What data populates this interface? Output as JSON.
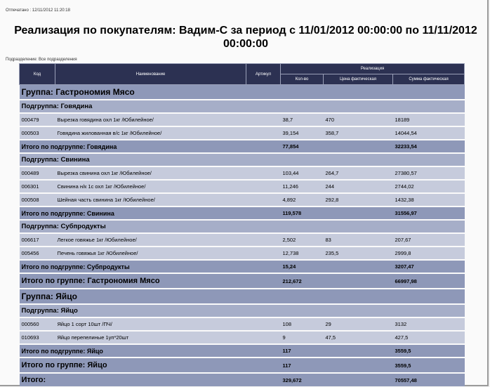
{
  "printed_label": "Отпечатано : 12/11/2012 11:20:18",
  "title": "Реализация по покупателям: Вадим-С за период с 11/01/2012 00:00:00 по 11/11/2012 00:00:00",
  "division_label": "Подразделение: Все подразделения",
  "headers": {
    "code": "Код",
    "name": "Наименование",
    "article": "Артикул",
    "sales": "Реализация",
    "qty": "Кол-во",
    "price": "Цена фактическая",
    "sum": "Сумма фактическая"
  },
  "rows": [
    {
      "type": "group",
      "label": "Группа: Гастрономия Мясо"
    },
    {
      "type": "sub",
      "label": "Подгруппа: Говядина"
    },
    {
      "type": "item",
      "code": "000479",
      "name": "Вырезка говядина охл 1кг /Юбилейное/",
      "article": "",
      "qty": "38,7",
      "price": "470",
      "sum": "18189"
    },
    {
      "type": "item",
      "code": "000503",
      "name": "Говядина жилованная в/с 1кг /Юбилейное/",
      "article": "",
      "qty": "39,154",
      "price": "358,7",
      "sum": "14044,54"
    },
    {
      "type": "subtotal",
      "label": "Итого по подгруппе: Говядина",
      "qty": "77,854",
      "sum": "32233,54"
    },
    {
      "type": "sub",
      "label": "Подгруппа: Свинина"
    },
    {
      "type": "item",
      "code": "000489",
      "name": "Вырезка свинина охл 1кг /Юбилейное/",
      "article": "",
      "qty": "103,44",
      "price": "264,7",
      "sum": "27380,57"
    },
    {
      "type": "item",
      "code": "006301",
      "name": "Свинина н/к 1с охл 1кг /Юбилейное/",
      "article": "",
      "qty": "11,246",
      "price": "244",
      "sum": "2744,02"
    },
    {
      "type": "item",
      "code": "000508",
      "name": "Шейная часть свинина 1кг /Юбилейное/",
      "article": "",
      "qty": "4,892",
      "price": "292,8",
      "sum": "1432,38"
    },
    {
      "type": "subtotal",
      "label": "Итого по подгруппе: Свинина",
      "qty": "119,578",
      "sum": "31556,97"
    },
    {
      "type": "sub",
      "label": "Подгруппа: Субпродукты"
    },
    {
      "type": "item",
      "code": "006617",
      "name": "Легкое говяжье 1кг /Юбилейное/",
      "article": "",
      "qty": "2,502",
      "price": "83",
      "sum": "207,67"
    },
    {
      "type": "item",
      "code": "005456",
      "name": "Печень говяжья 1кг /Юбилейное/",
      "article": "",
      "qty": "12,738",
      "price": "235,5",
      "sum": "2999,8"
    },
    {
      "type": "subtotal",
      "label": "Итого по подгруппе: Субпродукты",
      "qty": "15,24",
      "sum": "3207,47"
    },
    {
      "type": "gtotal",
      "label": "Итого по группе: Гастрономия Мясо",
      "qty": "212,672",
      "sum": "66997,98"
    },
    {
      "type": "group",
      "label": "Группа: Яйцо"
    },
    {
      "type": "sub",
      "label": "Подгруппа: Яйцо"
    },
    {
      "type": "item",
      "code": "000560",
      "name": "Яйцо 1 сорт 10шт /ПЧ/",
      "article": "",
      "qty": "108",
      "price": "29",
      "sum": "3132"
    },
    {
      "type": "item",
      "code": "010693",
      "name": "Яйцо перепелиные 1уп*20шт",
      "article": "",
      "qty": "9",
      "price": "47,5",
      "sum": "427,5"
    },
    {
      "type": "subtotal",
      "label": "Итого по подгруппе: Яйцо",
      "qty": "117",
      "sum": "3559,5"
    },
    {
      "type": "gtotal",
      "label": "Итого по группе: Яйцо",
      "qty": "117",
      "sum": "3559,5"
    },
    {
      "type": "total",
      "label": "Итого:",
      "qty": "329,672",
      "sum": "70557,48"
    }
  ]
}
